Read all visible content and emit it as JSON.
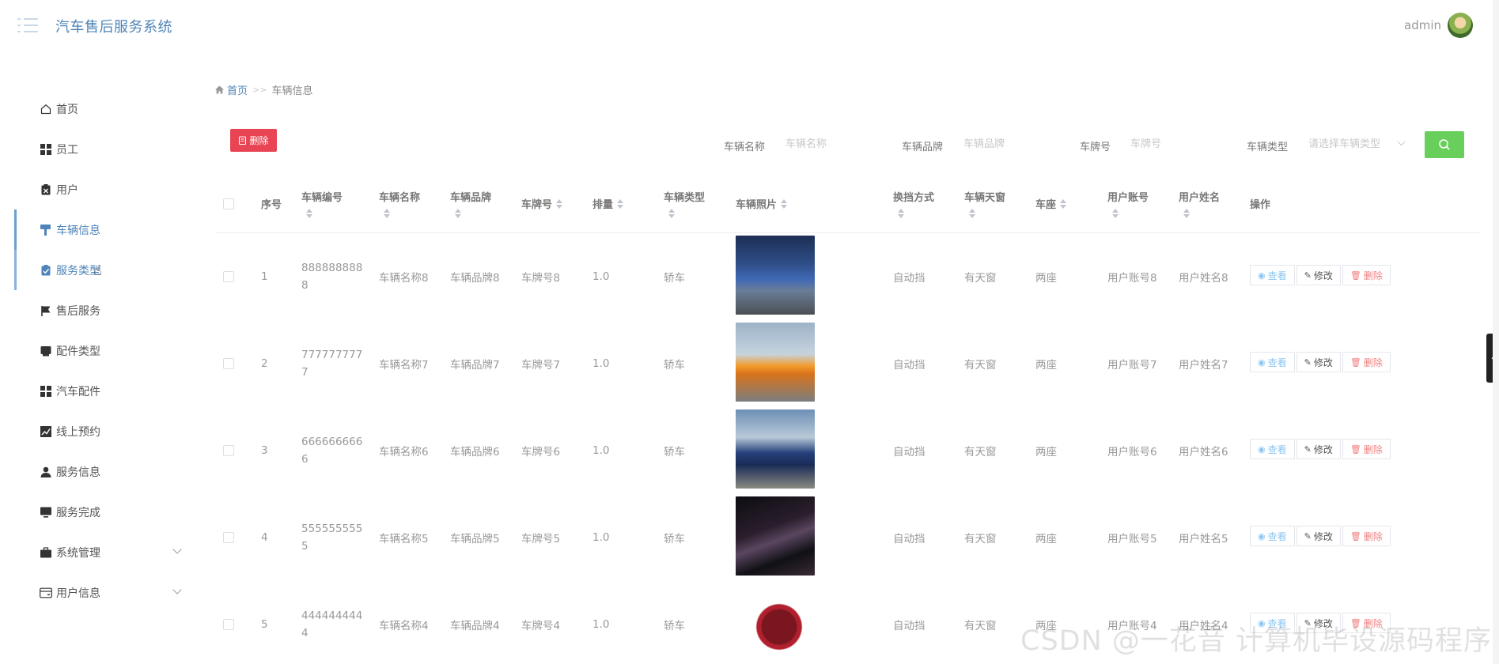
{
  "header": {
    "title": "汽车售后服务系统",
    "user": "admin"
  },
  "sidebar": {
    "items": [
      {
        "label": "首页",
        "icon": "home-icon"
      },
      {
        "label": "员工",
        "icon": "grid-icon"
      },
      {
        "label": "用户",
        "icon": "clipboard-x-icon"
      },
      {
        "label": "车辆信息",
        "icon": "paint-roller-icon"
      },
      {
        "label": "服务类型",
        "icon": "clipboard-check-icon"
      },
      {
        "label": "售后服务",
        "icon": "flag-icon"
      },
      {
        "label": "配件类型",
        "icon": "inbox-icon"
      },
      {
        "label": "汽车配件",
        "icon": "grid-icon"
      },
      {
        "label": "线上预约",
        "icon": "chart-line-icon"
      },
      {
        "label": "服务信息",
        "icon": "user-icon"
      },
      {
        "label": "服务完成",
        "icon": "monitor-icon"
      },
      {
        "label": "系统管理",
        "icon": "briefcase-icon"
      },
      {
        "label": "用户信息",
        "icon": "card-icon"
      }
    ]
  },
  "breadcrumb": {
    "home": "首页",
    "sep": ">>",
    "current": "车辆信息"
  },
  "toolbar": {
    "delete_label": "删除",
    "filters": [
      {
        "label": "车辆名称",
        "placeholder": "车辆名称"
      },
      {
        "label": "车辆品牌",
        "placeholder": "车辆品牌"
      },
      {
        "label": "车牌号",
        "placeholder": "车牌号"
      },
      {
        "label": "车辆类型",
        "placeholder": "请选择车辆类型"
      }
    ]
  },
  "table": {
    "headers": {
      "index": "序号",
      "code": "车辆编号",
      "name": "车辆名称",
      "brand": "车辆品牌",
      "plate": "车牌号",
      "displacement": "排量",
      "type": "车辆类型",
      "photo": "车辆照片",
      "gear": "换挡方式",
      "sunroof": "车辆天窗",
      "seats": "车座",
      "account": "用户账号",
      "username": "用户姓名",
      "actions": "操作"
    },
    "actions": {
      "view": "查看",
      "edit": "修改",
      "delete": "删除"
    },
    "rows": [
      {
        "index": "1",
        "code": "8888888888",
        "name": "车辆名称8",
        "brand": "车辆品牌8",
        "plate": "车牌号8",
        "displacement": "1.0",
        "type": "轿车",
        "gear": "自动挡",
        "sunroof": "有天窗",
        "seats": "两座",
        "account": "用户账号8",
        "username": "用户姓名8"
      },
      {
        "index": "2",
        "code": "7777777777",
        "name": "车辆名称7",
        "brand": "车辆品牌7",
        "plate": "车牌号7",
        "displacement": "1.0",
        "type": "轿车",
        "gear": "自动挡",
        "sunroof": "有天窗",
        "seats": "两座",
        "account": "用户账号7",
        "username": "用户姓名7"
      },
      {
        "index": "3",
        "code": "6666666666",
        "name": "车辆名称6",
        "brand": "车辆品牌6",
        "plate": "车牌号6",
        "displacement": "1.0",
        "type": "轿车",
        "gear": "自动挡",
        "sunroof": "有天窗",
        "seats": "两座",
        "account": "用户账号6",
        "username": "用户姓名6"
      },
      {
        "index": "4",
        "code": "5555555555",
        "name": "车辆名称5",
        "brand": "车辆品牌5",
        "plate": "车牌号5",
        "displacement": "1.0",
        "type": "轿车",
        "gear": "自动挡",
        "sunroof": "有天窗",
        "seats": "两座",
        "account": "用户账号5",
        "username": "用户姓名5"
      },
      {
        "index": "5",
        "code": "4444444444",
        "name": "车辆名称4",
        "brand": "车辆品牌4",
        "plate": "车牌号4",
        "displacement": "1.0",
        "type": "轿车",
        "gear": "自动挡",
        "sunroof": "有天窗",
        "seats": "两座",
        "account": "用户账号4",
        "username": "用户姓名4"
      }
    ]
  },
  "colors": {
    "accent": "#4f84b8",
    "danger": "#e84453",
    "search": "#67cf5a"
  },
  "watermark": "CSDN @一花音 计算机毕设源码程序"
}
